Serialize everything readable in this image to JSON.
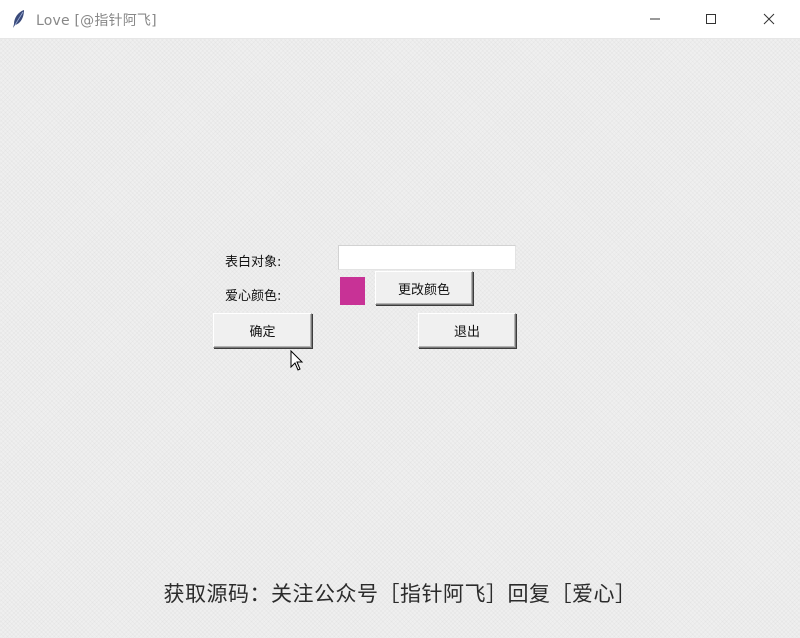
{
  "window": {
    "title": "Love  [@指针阿飞]"
  },
  "form": {
    "target_label": "表白对象:",
    "target_value": "",
    "heart_color_label": "爱心颜色:",
    "heart_color": "#c83296",
    "change_color_button": "更改颜色",
    "ok_button": "确定",
    "exit_button": "退出"
  },
  "footer": {
    "text": "获取源码：关注公众号［指针阿飞］回复［爱心］"
  },
  "icons": {
    "app": "feather-icon",
    "minimize": "minimize-icon",
    "maximize": "maximize-icon",
    "close": "close-icon",
    "cursor": "mouse-cursor-icon"
  }
}
